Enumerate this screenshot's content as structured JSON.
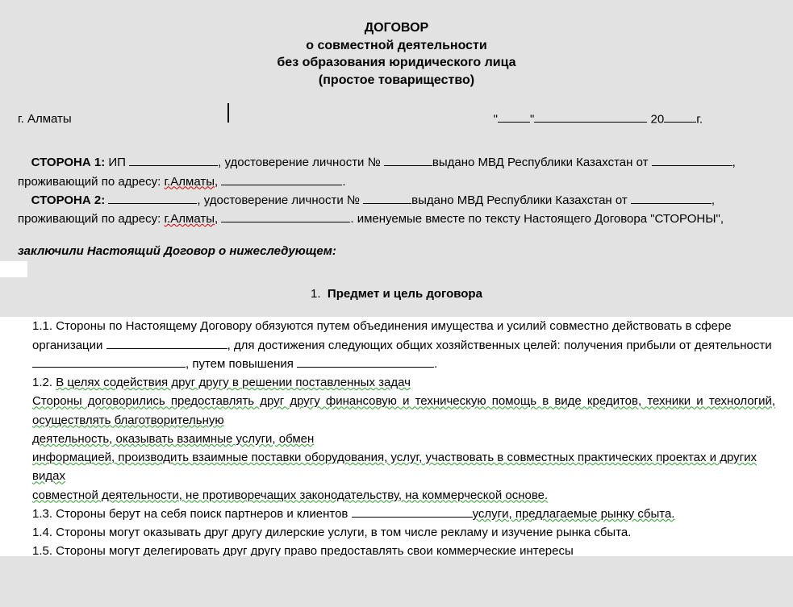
{
  "title": {
    "l1": "ДОГОВОР",
    "l2": "о совместной деятельности",
    "l3": "без образования юридического лица",
    "l4": "(простое товарищество)"
  },
  "header": {
    "city": "г. Алматы",
    "quote_open": "\"",
    "quote_close": "\"",
    "year_prefix": " 20",
    "year_suffix": "г."
  },
  "parties": {
    "p1_label": "СТОРОНА 1:",
    "p2_label": "СТОРОНА 2:",
    "ip": " ИП  ",
    "udost": ", удостоверение личности №  ",
    "vydano": "выдано МВД Республики Казахстан от ",
    "addr": ", проживающий по адресу: ",
    "gAlmaty": "г.Алматы",
    "comma_blank_dot": ", ",
    "dot": ".",
    "named": " именуемые вместе по тексту Настоящего Договора \"СТОРОНЫ\","
  },
  "concluded": "заключили Настоящий Договор о нижеследующем:",
  "section1": {
    "num": "1.",
    "title": "Предмет и цель договора"
  },
  "body": {
    "c1_1a": "1.1. Стороны по Настоящему Договору обязуются путем объединения имущества и усилий совместно действовать  в сфере организации   ",
    "c1_1b": ",  для достижения следующих общих хозяйственных целей: получения прибыли от деятельности ",
    "c1_1c": ", путем повышения ",
    "c1_1d": ".",
    "c1_2a": "1.2.  ",
    "c1_2b": "В целях  содействия  друг  другу  в  решении  поставленных  задач",
    "c1_2c": "Стороны  договорились  предоставлять  друг  другу  финансовую  и техническую  помощь  в виде  кредитов,  техники  и технологий,  осуществлять  благотворительную",
    "c1_2d": "деятельность,  оказывать  взаимные  услуги,  обмен",
    "c1_2e": "информацией,  производить  взаимные  поставки  оборудования,  услуг,  участвовать  в  совместных практических  проектах и других видах",
    "c1_2f": "совместной  деятельности,  не  противоречащих   законодательству,  на  коммерческой  основе.",
    "c1_3a": "1.3.  Стороны  берут  на  себя  поиск  партнеров  и  клиентов  ",
    "c1_3b": "услуги,  предлагаемые  рынку сбыта.",
    "c1_4": "1.4. Стороны могут оказывать друг другу дилерские услуги,  в том числе рекламу и   изучение рынка сбыта.",
    "c1_5": "1.5. Стороны могут делегировать друг другу право предоставлять свои коммерческие интересы"
  }
}
